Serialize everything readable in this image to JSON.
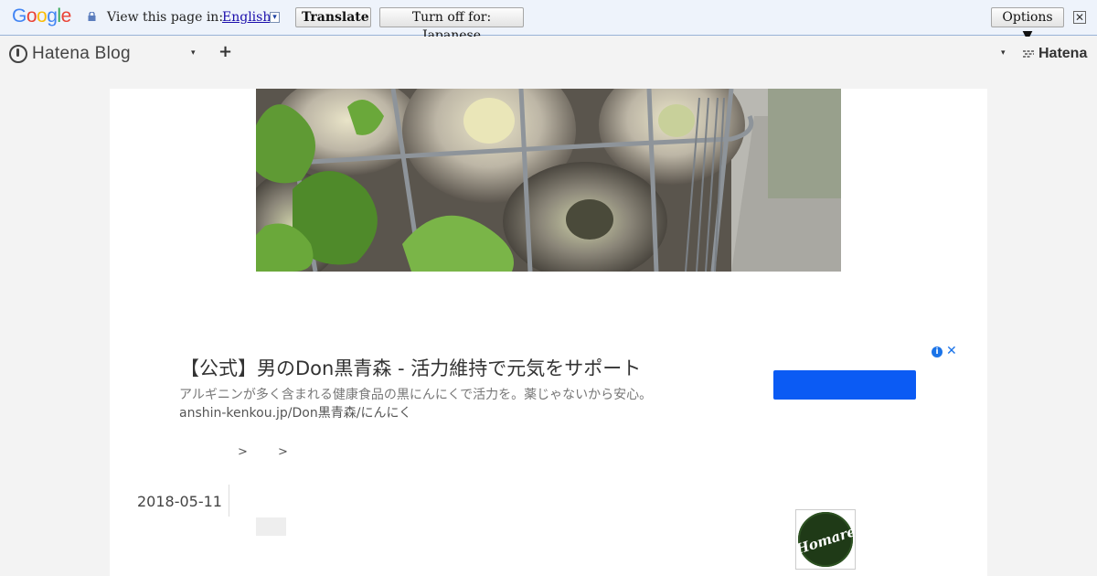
{
  "translate_bar": {
    "logo_letters": [
      {
        "ch": "G",
        "color": "#4285f4"
      },
      {
        "ch": "o",
        "color": "#ea4335"
      },
      {
        "ch": "o",
        "color": "#fbbc05"
      },
      {
        "ch": "g",
        "color": "#4285f4"
      },
      {
        "ch": "l",
        "color": "#34a853"
      },
      {
        "ch": "e",
        "color": "#ea4335"
      }
    ],
    "label": "View this page in:",
    "language": "English",
    "caret": "▾",
    "translate_button": "Translate",
    "turn_off_button": "Turn off for: Japanese",
    "options_button": "Options ▼",
    "close": "✕"
  },
  "blog_header": {
    "title": "Hatena Blog",
    "dropdown": "▾",
    "plus": "+",
    "user_dropdown": "▾",
    "hatena_label": "Hatena"
  },
  "ad": {
    "headline": "【公式】男のDon黒青森 - 活力維持で元気をサポート",
    "description": "アルギニンが多く含まれる健康食品の黒にんにくで活力を。薬じゃないから安心。",
    "url": "anshin-kenkou.jp/Don黒青森/にんにく",
    "info_icon": "i",
    "close_icon": "✕",
    "button_color": "#0b5bf4"
  },
  "breadcrumb": {
    "sep1": ">",
    "sep2": ">"
  },
  "entry": {
    "date": "2018-05-11"
  },
  "sidebar": {
    "avatar_text": "Homare"
  }
}
